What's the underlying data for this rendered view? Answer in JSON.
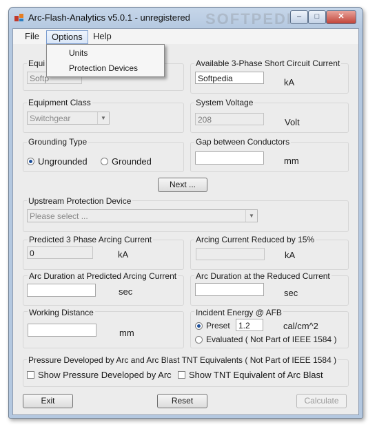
{
  "window": {
    "title": "Arc-Flash-Analytics v5.0.1 - unregistered",
    "minimize": "–",
    "maximize": "□",
    "close": "✕"
  },
  "watermark": "SOFTPEDIA",
  "menu": {
    "file": "File",
    "options": "Options",
    "help": "Help",
    "options_items": [
      "Units",
      "Protection Devices"
    ]
  },
  "equipment": {
    "label": "Equi",
    "value": "Softp"
  },
  "short_circuit": {
    "label": "Available 3-Phase Short Circuit Current",
    "value": "Softpedia",
    "unit": "kA"
  },
  "equipment_class": {
    "label": "Equipment Class",
    "value": "Switchgear"
  },
  "system_voltage": {
    "label": "System Voltage",
    "value": "208",
    "unit": "Volt"
  },
  "grounding": {
    "label": "Grounding Type",
    "options": [
      "Ungrounded",
      "Grounded"
    ],
    "selected": "Ungrounded"
  },
  "gap": {
    "label": "Gap between Conductors",
    "value": "",
    "unit": "mm"
  },
  "next_button": "Next ...",
  "upstream": {
    "label": "Upstream Protection Device",
    "placeholder": "Please select ..."
  },
  "predicted_arcing": {
    "label": "Predicted 3 Phase Arcing Current",
    "value": "0",
    "unit": "kA"
  },
  "reduced_arcing": {
    "label": "Arcing Current Reduced by 15%",
    "value": "",
    "unit": "kA"
  },
  "arc_duration_pred": {
    "label": "Arc Duration at Predicted Arcing Current",
    "value": "",
    "unit": "sec"
  },
  "arc_duration_red": {
    "label": "Arc Duration at the Reduced Current",
    "value": "",
    "unit": "sec"
  },
  "working_distance": {
    "label": "Working Distance",
    "value": "",
    "unit": "mm"
  },
  "incident_energy": {
    "label": "Incident Energy @ AFB",
    "preset_label": "Preset",
    "preset_value": "1.2",
    "unit": "cal/cm^2",
    "evaluated_label": "Evaluated  ( Not Part of IEEE 1584 )",
    "selected": "Preset"
  },
  "pressure": {
    "label": "Pressure Developed by Arc and Arc Blast TNT Equivalents ( Not Part of IEEE 1584 )",
    "show_pressure": "Show Pressure Developed by Arc",
    "show_tnt": "Show TNT Equivalent of Arc Blast"
  },
  "buttons": {
    "exit": "Exit",
    "reset": "Reset",
    "calculate": "Calculate"
  }
}
